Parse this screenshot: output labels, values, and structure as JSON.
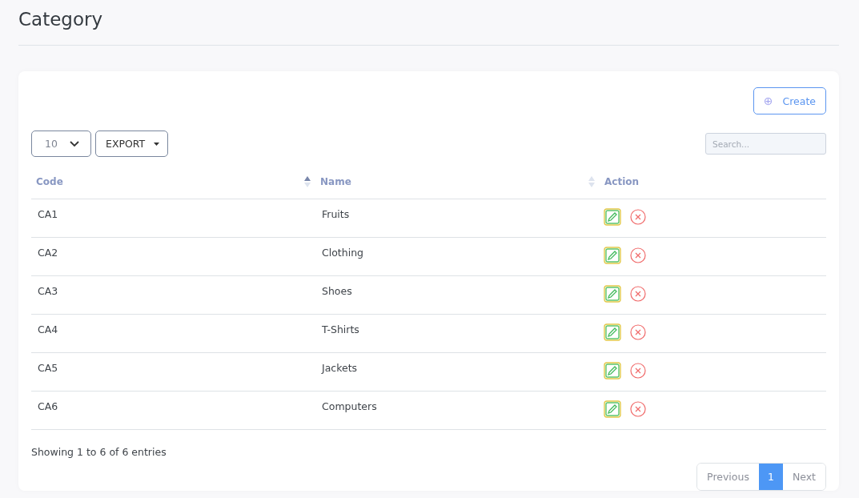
{
  "page_title": "Category",
  "create_button": {
    "icon": "⊕",
    "label": "Create"
  },
  "page_size": {
    "value": "10"
  },
  "export_button": {
    "label": "EXPORT"
  },
  "search": {
    "placeholder": "Search..."
  },
  "table": {
    "columns": [
      {
        "label": "Code",
        "sortable": true,
        "sorted": true
      },
      {
        "label": "Name",
        "sortable": true,
        "sorted": false
      },
      {
        "label": "Action",
        "sortable": false,
        "sorted": false
      }
    ],
    "rows": [
      {
        "code": "CA1",
        "name": "Fruits"
      },
      {
        "code": "CA2",
        "name": "Clothing"
      },
      {
        "code": "CA3",
        "name": "Shoes"
      },
      {
        "code": "CA4",
        "name": "T-Shirts"
      },
      {
        "code": "CA5",
        "name": "Jackets"
      },
      {
        "code": "CA6",
        "name": "Computers"
      }
    ]
  },
  "info": "Showing 1 to 6 of 6 entries",
  "pagination": {
    "previous": "Previous",
    "next": "Next",
    "pages": [
      {
        "label": "1",
        "selected": true
      }
    ]
  }
}
